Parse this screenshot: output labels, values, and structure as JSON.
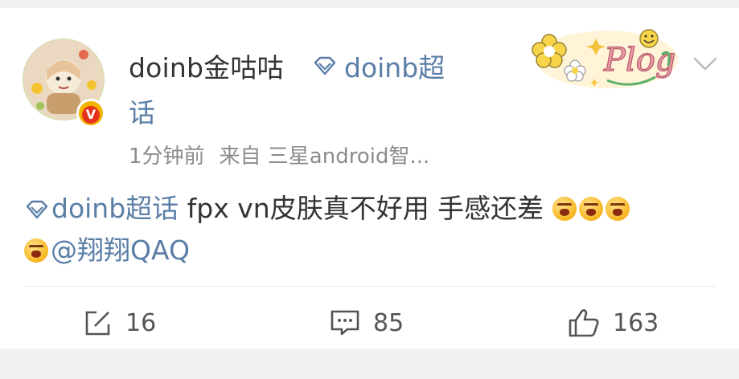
{
  "post": {
    "author": "doinb金咕咕",
    "topic_badge": "doinb超话",
    "topic_badge_line1": "doinb超",
    "topic_badge_line2": "话",
    "time": "1分钟前",
    "source": "来自 三星android智...",
    "text_topic": "doinb超话",
    "text_body": " fpx vn皮肤真不好用 手感还差 ",
    "mention": "@翔翔QAQ",
    "emoji_name": "angry-face-emoji",
    "verified_badge": "V"
  },
  "actions": {
    "repost_count": "16",
    "comment_count": "85",
    "like_count": "163"
  },
  "colors": {
    "link": "#5a7ea6",
    "text": "#333333",
    "meta": "#8b8b8b",
    "background": "#f1f1f1"
  },
  "icons": [
    "avatar",
    "verified-badge-icon",
    "diamond-topic-icon",
    "plog-sticker",
    "chevron-down-icon",
    "repost-icon",
    "comment-icon",
    "like-icon",
    "angry-face-emoji"
  ]
}
